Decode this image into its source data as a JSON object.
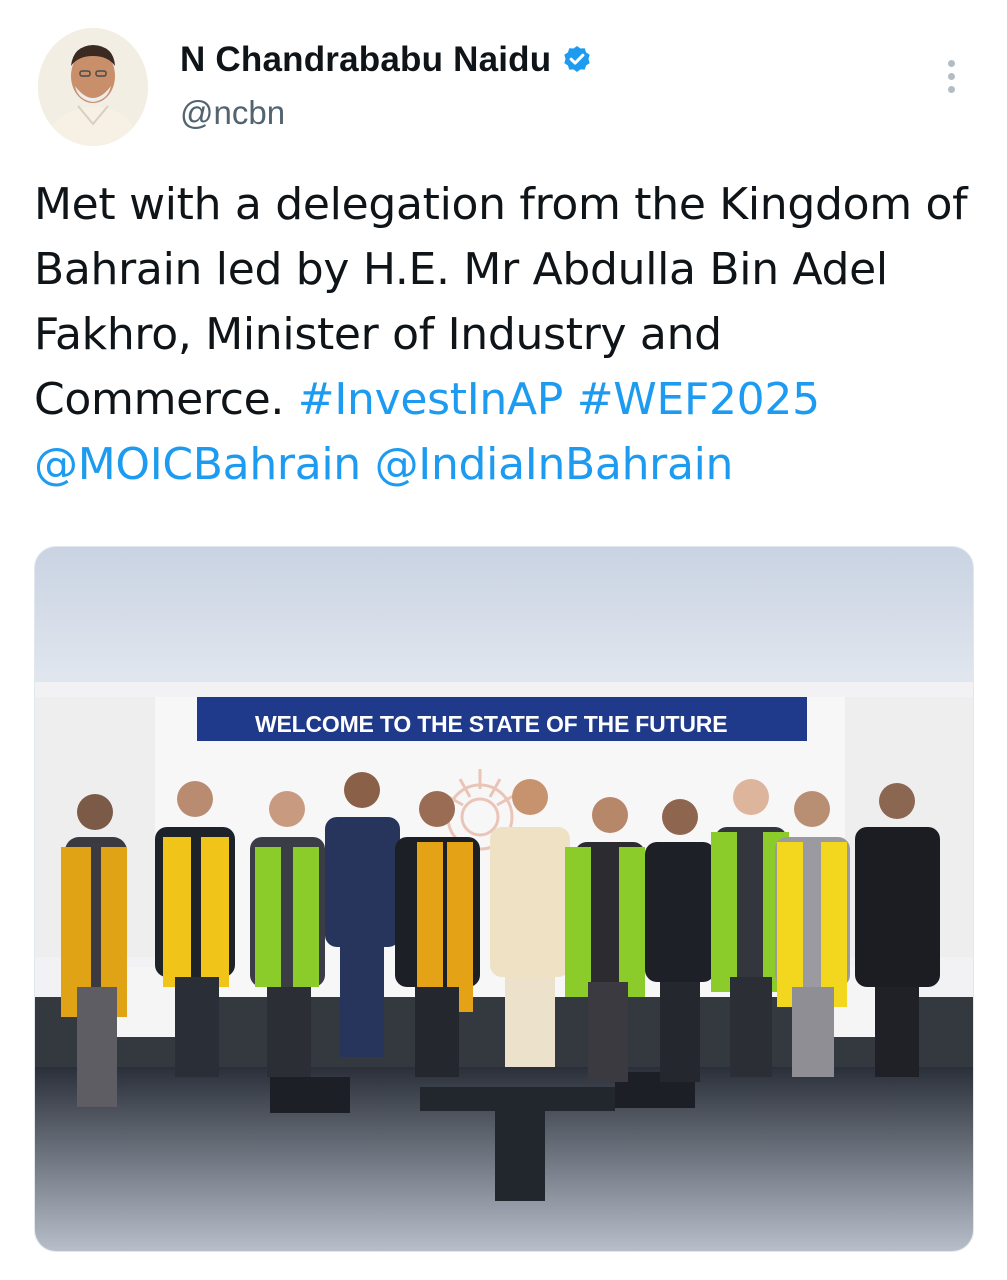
{
  "author": {
    "name": "N Chandrababu Naidu",
    "handle": "@ncbn",
    "verified": true,
    "avatar_icon": "profile-photo"
  },
  "tweet": {
    "text_before": "Met with a delegation from the Kingdom of Bahrain led by H.E. Mr Abdulla Bin Adel Fakhro, Minister of Industry and Commerce. ",
    "hashtags": [
      "#InvestInAP",
      "#WEF2025"
    ],
    "mentions": [
      "@MOICBahrain",
      "@IndiaInBahrain"
    ]
  },
  "media": {
    "banner_text": "WELCOME TO THE STATE OF THE FUTURE"
  },
  "colors": {
    "link": "#1d9bf0",
    "verified_badge": "#1d9bf0",
    "banner": "#1f3a8a"
  },
  "icons": {
    "more": "more-options-icon",
    "verified": "verified-badge-icon"
  }
}
